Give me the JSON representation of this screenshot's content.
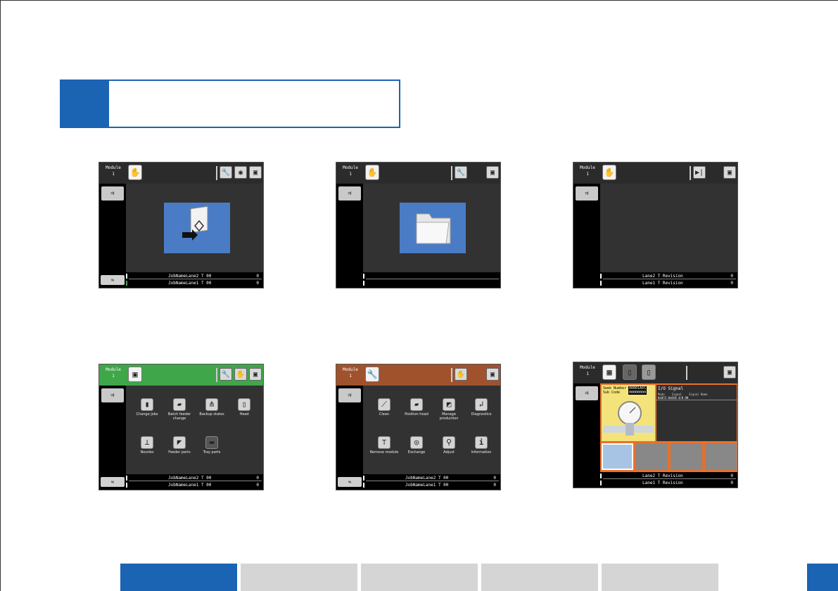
{
  "title": "",
  "screens": [
    {
      "module_label": "Module",
      "module_number": "1",
      "rows": [
        {
          "name": "JobNameLane2 T 00",
          "value": "0"
        },
        {
          "name": "JobNameLane1 T 00",
          "value": "0"
        }
      ]
    },
    {
      "module_label": "Module",
      "module_number": "1",
      "rows": [
        {
          "name": "",
          "value": ""
        },
        {
          "name": "",
          "value": ""
        }
      ]
    },
    {
      "module_label": "Module",
      "module_number": "1",
      "rows": [
        {
          "name": "Lane2 T Revision",
          "value": "0"
        },
        {
          "name": "Lane1 T Revision",
          "value": "0"
        }
      ]
    },
    {
      "module_label": "Module",
      "module_number": "1",
      "menu": [
        "Change jobs",
        "Batch feeder change",
        "Backup states",
        "Head",
        "Nozzles",
        "Feeder parts",
        "Tray parts"
      ],
      "rows": [
        {
          "name": "JobNameLane2 T 00",
          "value": "0"
        },
        {
          "name": "JobNameLane1 T 00",
          "value": "0"
        }
      ]
    },
    {
      "module_label": "Module",
      "module_number": "1",
      "menu": [
        "Clean",
        "Position head",
        "Manage production",
        "Diagnostics",
        "Remove module",
        "Exchange",
        "Adjust",
        "Information"
      ],
      "rows": [
        {
          "name": "JobNameLane2 T 00",
          "value": "0"
        },
        {
          "name": "JobNameLane1 T 00",
          "value": "0"
        }
      ]
    },
    {
      "module_label": "Module",
      "module_number": "1",
      "seek_label": "Seek Number",
      "seek_value": "00001A01",
      "sub_label": "Sub Code",
      "sub_value": "00000000",
      "io_title": "I/O Signal",
      "io_headers": [
        "Mode",
        "Signal",
        "Signal Name"
      ],
      "io_row": "0x073  0x010  4/8 OK",
      "rows": [
        {
          "name": "Lane2 T Revision",
          "value": "0"
        },
        {
          "name": "Lane1 T Revision",
          "value": "0"
        }
      ]
    }
  ],
  "colors": {
    "accent": "#1b64b4",
    "screen_bg": "#323232",
    "green_bar": "#3fa64a",
    "brown_bar": "#a0522d",
    "blue_panel": "#4a7cc6",
    "nav_inactive": "#d5d5d5"
  }
}
